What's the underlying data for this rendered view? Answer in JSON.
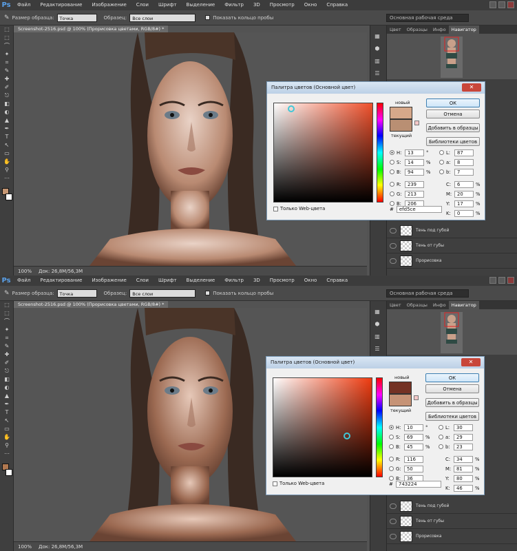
{
  "app": {
    "menus": [
      "Файл",
      "Редактирование",
      "Изображение",
      "Слои",
      "Шрифт",
      "Выделение",
      "Фильтр",
      "3D",
      "Просмотр",
      "Окно",
      "Справка"
    ],
    "options": {
      "sample_size_label": "Размер образца:",
      "sample_size_value": "Точка",
      "sample_label": "Образец:",
      "sample_value": "Все слои",
      "ring_label": "Показать кольцо пробы",
      "workspace": "Основная рабочая среда"
    },
    "doc_tab": "Screenshot-2516.psd @ 100% (Прорисовка цветами, RGB/8#) *",
    "status": {
      "zoom": "100%",
      "doc": "Док: 26,8M/56,3M"
    },
    "panel_tabs": [
      "Цвет",
      "Образцы",
      "Инфо",
      "Навигатор"
    ],
    "layers": [
      "Тень под губой",
      "Тень от губы",
      "Прорисовка"
    ],
    "colors": {
      "accent": "#5aa0e8",
      "panel": "#3f3f3f",
      "dialog": "#f0f0f0"
    }
  },
  "dialog": {
    "title": "Палитра цветов (Основной цвет)",
    "new_label": "новый",
    "current_label": "текущий",
    "ok": "ОК",
    "cancel": "Отмена",
    "add_swatch": "Добавить в образцы",
    "libraries": "Библиотеки цветов",
    "web_only": "Только Web-цвета",
    "hash": "#",
    "labels": {
      "H": "H:",
      "S": "S:",
      "B": "B:",
      "R": "R:",
      "G": "G:",
      "B2": "B:",
      "L": "L:",
      "a": "a:",
      "b": "b:",
      "C": "C:",
      "M": "M:",
      "Y": "Y:",
      "K": "K:"
    },
    "units": {
      "deg": "°",
      "pct": "%"
    }
  },
  "top": {
    "H": "13",
    "S": "14",
    "B": "94",
    "R": "239",
    "G": "213",
    "Bb": "206",
    "L": "87",
    "a": "8",
    "b": "7",
    "C": "6",
    "M": "20",
    "Y": "17",
    "K": "0",
    "hex": "efd5ce",
    "new_color": "#d6a88a",
    "current_color": "#b98f73",
    "field_base": "#ef4f2a"
  },
  "bottom": {
    "H": "10",
    "S": "69",
    "B": "45",
    "R": "116",
    "G": "50",
    "Bb": "36",
    "L": "30",
    "a": "29",
    "b": "23",
    "C": "34",
    "M": "81",
    "Y": "80",
    "K": "46",
    "hex": "743224",
    "new_color": "#743224",
    "current_color": "#c69376",
    "field_base": "#ef3b10"
  }
}
